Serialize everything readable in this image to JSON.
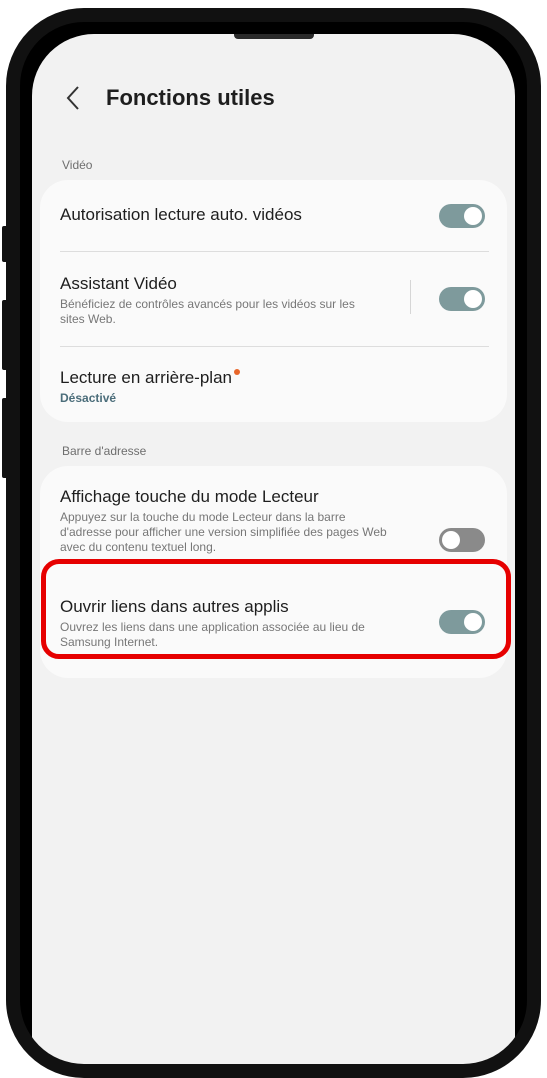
{
  "header": {
    "title": "Fonctions utiles",
    "back_icon": "chevron-left-icon"
  },
  "sections": {
    "video": {
      "label": "Vidéo",
      "items": [
        {
          "title": "Autorisation lecture auto. vidéos",
          "subtitle": "",
          "toggle": "on"
        },
        {
          "title": "Assistant Vidéo",
          "subtitle": "Bénéficiez de contrôles avancés pour les vidéos sur les sites Web.",
          "toggle": "on"
        },
        {
          "title": "Lecture en arrière-plan",
          "subtitle": "Désactivé",
          "badge": "new-dot"
        }
      ]
    },
    "address_bar": {
      "label": "Barre d'adresse",
      "items": [
        {
          "title": "Affichage touche du mode Lecteur",
          "subtitle": "Appuyez sur la touche du mode Lecteur dans la barre d'adresse pour afficher une version simplifiée des pages Web avec du contenu textuel long.",
          "toggle": "off"
        },
        {
          "title": "Ouvrir liens dans autres applis",
          "subtitle": "Ouvrez les liens dans une application associée au lieu de Samsung Internet.",
          "toggle": "on"
        }
      ]
    }
  },
  "colors": {
    "toggle_on": "#7e9a9c",
    "toggle_off": "#8a8a8a",
    "highlight": "#e60000",
    "badge_dot": "#e8662a",
    "accent_text": "#4b6d7a"
  }
}
